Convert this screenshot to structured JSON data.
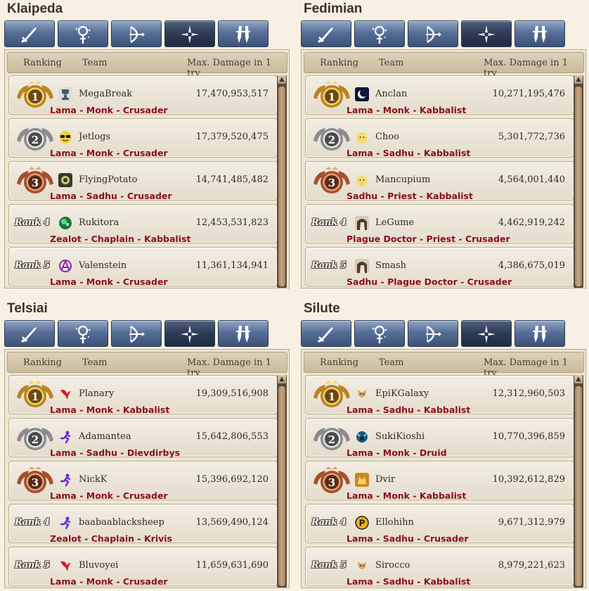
{
  "header": {
    "ranking": "Ranking",
    "team": "Team",
    "damage": "Max. Damage in 1 try"
  },
  "colors": {
    "tab_bg": "#566f97",
    "tab_active": "#2c3a55",
    "class_text": "#8a1020",
    "gold": "#d9a441",
    "silver": "#a9a9a9",
    "bronze": "#b06a45"
  },
  "tab_icons": [
    "sword-icon",
    "magic-staff-icon",
    "bow-icon",
    "cross-star-icon",
    "dual-blade-icon"
  ],
  "servers": [
    {
      "name": "Klaipeda",
      "rows": [
        {
          "rank": "1",
          "name": "MegaBreak",
          "damage": "17,470,953,517",
          "classes": "Lama - Monk - Crusader",
          "avatar": "trophy-avatar"
        },
        {
          "rank": "2",
          "name": "Jetlogs",
          "damage": "17,379,520,475",
          "classes": "Lama - Monk - Crusader",
          "avatar": "sunglasses-avatar"
        },
        {
          "rank": "3",
          "name": "FlyingPotato",
          "damage": "14,741,485,482",
          "classes": "Lama - Sadhu - Crusader",
          "avatar": "emblem-avatar"
        },
        {
          "rank": "Rank 4",
          "name": "Rukitora",
          "damage": "12,453,531,823",
          "classes": "Zealot - Chaplain - Kabbalist",
          "avatar": "green-orb-avatar"
        },
        {
          "rank": "Rank 5",
          "name": "Valenstein",
          "damage": "11,361,134,941",
          "classes": "Lama - Monk - Crusader",
          "avatar": "purple-anarchy-avatar"
        }
      ]
    },
    {
      "name": "Fedimian",
      "rows": [
        {
          "rank": "1",
          "name": "Anclan",
          "damage": "10,271,195,476",
          "classes": "Lama - Monk - Kabbalist",
          "avatar": "moon-avatar"
        },
        {
          "rank": "2",
          "name": "Choo",
          "damage": "5,301,772,736",
          "classes": "Lama - Sadhu - Kabbalist",
          "avatar": "chick-avatar"
        },
        {
          "rank": "3",
          "name": "Mancupium",
          "damage": "4,564,001,440",
          "classes": "Sadhu - Priest - Kabbalist",
          "avatar": "chick-avatar"
        },
        {
          "rank": "Rank 4",
          "name": "LeGume",
          "damage": "4,462,919,242",
          "classes": "Plague Doctor - Priest - Crusader",
          "avatar": "portrait-avatar"
        },
        {
          "rank": "Rank 5",
          "name": "Smash",
          "damage": "4,386,675,019",
          "classes": "Sadhu - Plague Doctor - Crusader",
          "avatar": "portrait-avatar"
        }
      ]
    },
    {
      "name": "Telsiai",
      "rows": [
        {
          "rank": "1",
          "name": "Planary",
          "damage": "19,309,516,908",
          "classes": "Lama - Monk - Kabbalist",
          "avatar": "red-bird-avatar"
        },
        {
          "rank": "2",
          "name": "Adamantea",
          "damage": "15,642,806,553",
          "classes": "Lama - Sadhu - Dievdirbys",
          "avatar": "purple-runner-avatar"
        },
        {
          "rank": "3",
          "name": "NickK",
          "damage": "15,396,692,120",
          "classes": "Lama - Monk - Crusader",
          "avatar": "purple-runner-avatar"
        },
        {
          "rank": "Rank 4",
          "name": "baabaablacksheep",
          "damage": "13,569,490,124",
          "classes": "Zealot - Chaplain - Krivis",
          "avatar": "purple-runner-avatar"
        },
        {
          "rank": "Rank 5",
          "name": "Bluvoyei",
          "damage": "11,659,631,690",
          "classes": "Lama - Monk - Crusader",
          "avatar": "red-bird-avatar"
        }
      ]
    },
    {
      "name": "Silute",
      "rows": [
        {
          "rank": "1",
          "name": "EpiKGalaxy",
          "damage": "12,312,960,503",
          "classes": "Lama - Sadhu - Kabbalist",
          "avatar": "fox-avatar"
        },
        {
          "rank": "2",
          "name": "SukiKioshi",
          "damage": "10,770,396,859",
          "classes": "Lama - Monk - Druid",
          "avatar": "blue-beast-avatar"
        },
        {
          "rank": "3",
          "name": "Dvir",
          "damage": "10,392,612,829",
          "classes": "Lama - Monk - Kabbalist",
          "avatar": "cat-avatar"
        },
        {
          "rank": "Rank 4",
          "name": "Ellohihn",
          "damage": "9,671,312,979",
          "classes": "Lama - Sadhu - Crusader",
          "avatar": "p-badge-avatar"
        },
        {
          "rank": "Rank 5",
          "name": "Sirocco",
          "damage": "8,979,221,623",
          "classes": "Lama - Sadhu - Kabbalist",
          "avatar": "fox-avatar"
        }
      ]
    }
  ]
}
